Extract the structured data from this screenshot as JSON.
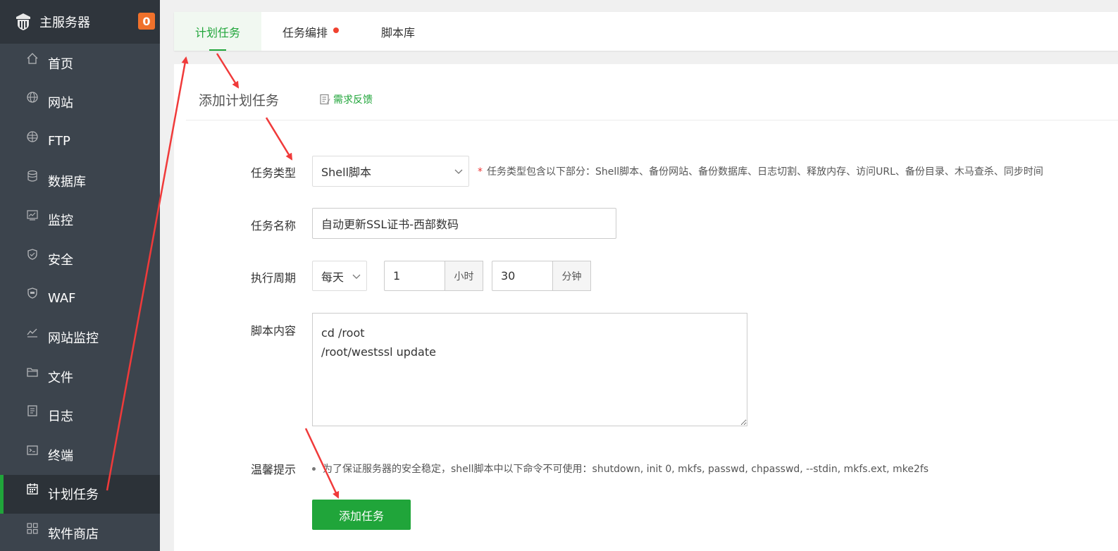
{
  "sidebar": {
    "server_title": "主服务器",
    "badge_count": "0",
    "items": [
      {
        "label": "首页",
        "icon": "home-icon"
      },
      {
        "label": "网站",
        "icon": "globe-icon"
      },
      {
        "label": "FTP",
        "icon": "ftp-icon"
      },
      {
        "label": "数据库",
        "icon": "database-icon"
      },
      {
        "label": "监控",
        "icon": "monitor-icon"
      },
      {
        "label": "安全",
        "icon": "shield-icon"
      },
      {
        "label": "WAF",
        "icon": "waf-shield-icon"
      },
      {
        "label": "网站监控",
        "icon": "chart-line-icon"
      },
      {
        "label": "文件",
        "icon": "folder-icon"
      },
      {
        "label": "日志",
        "icon": "log-icon"
      },
      {
        "label": "终端",
        "icon": "terminal-icon"
      },
      {
        "label": "计划任务",
        "icon": "calendar-icon",
        "active": true
      },
      {
        "label": "软件商店",
        "icon": "apps-grid-icon"
      }
    ]
  },
  "tabs": [
    {
      "label": "计划任务",
      "active": true
    },
    {
      "label": "任务编排",
      "has_dot": true
    },
    {
      "label": "脚本库"
    }
  ],
  "panel": {
    "title": "添加计划任务",
    "feedback_label": "需求反馈"
  },
  "form": {
    "task_type_label": "任务类型",
    "task_type_value": "Shell脚本",
    "task_type_hint": "任务类型包含以下部分：Shell脚本、备份网站、备份数据库、日志切割、释放内存、访问URL、备份目录、木马查杀、同步时间",
    "task_name_label": "任务名称",
    "task_name_value": "自动更新SSL证书-西部数码",
    "period_label": "执行周期",
    "period_value": "每天",
    "hour_value": "1",
    "hour_unit": "小时",
    "minute_value": "30",
    "minute_unit": "分钟",
    "script_label": "脚本内容",
    "script_value": "cd /root\n/root/westssl update",
    "tips_label": "温馨提示",
    "tips_text": "为了保证服务器的安全稳定，shell脚本中以下命令不可使用：shutdown, init 0, mkfs, passwd, chpasswd, --stdin, mkfs.ext, mke2fs",
    "submit_label": "添加任务"
  },
  "colors": {
    "accent": "#20a53a",
    "sidebar_bg": "#3c444d",
    "badge": "#f0712b",
    "annotation_arrow": "#f03a3a"
  }
}
